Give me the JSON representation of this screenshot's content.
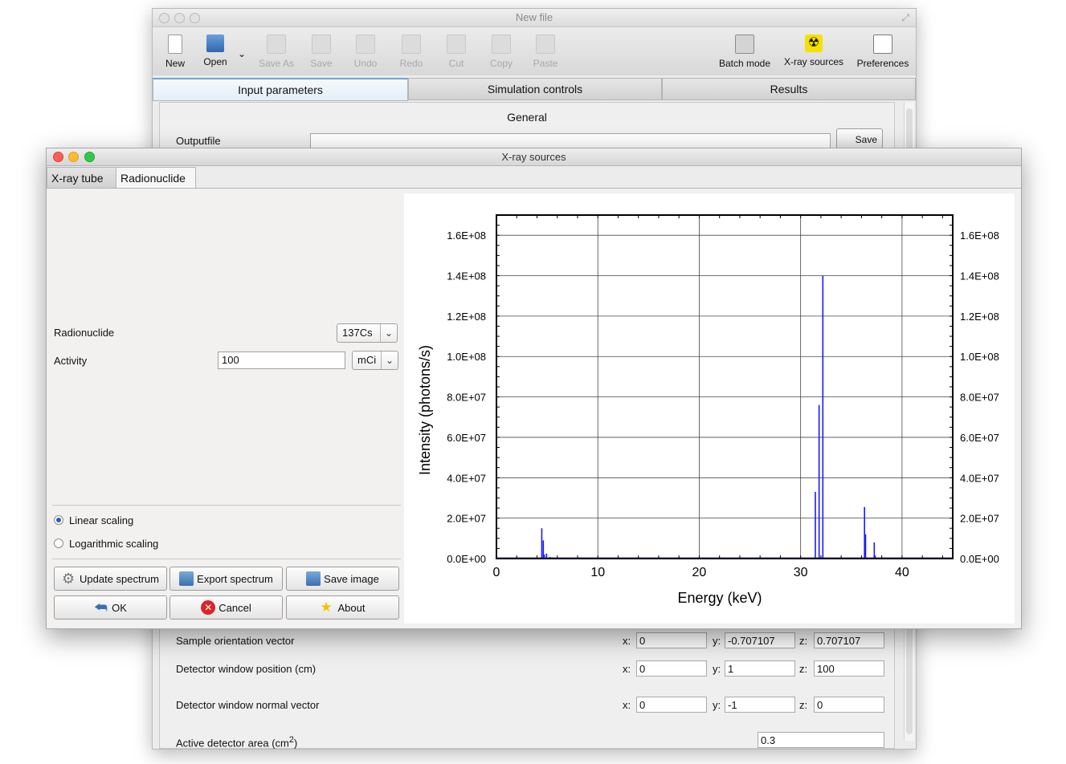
{
  "main_window": {
    "title": "New file",
    "toolbar": [
      {
        "label": "New",
        "icon": "new-file-icon",
        "enabled": true
      },
      {
        "label": "Open",
        "icon": "open-folder-icon",
        "enabled": true
      },
      {
        "label": "Save As",
        "icon": "save-as-icon",
        "enabled": false
      },
      {
        "label": "Save",
        "icon": "save-icon",
        "enabled": false
      },
      {
        "label": "Undo",
        "icon": "undo-icon",
        "enabled": false
      },
      {
        "label": "Redo",
        "icon": "redo-icon",
        "enabled": false
      },
      {
        "label": "Cut",
        "icon": "scissors-icon",
        "enabled": false
      },
      {
        "label": "Copy",
        "icon": "copy-icon",
        "enabled": false
      },
      {
        "label": "Paste",
        "icon": "paste-icon",
        "enabled": false
      }
    ],
    "toolbar_right": [
      {
        "label": "Batch mode",
        "icon": "batch-mode-icon"
      },
      {
        "label": "X-ray sources",
        "icon": "radiation-icon"
      },
      {
        "label": "Preferences",
        "icon": "preferences-icon"
      }
    ],
    "tabs": [
      "Input parameters",
      "Simulation controls",
      "Results"
    ],
    "active_tab": "Input parameters",
    "section_title": "General",
    "outputfile_label": "Outputfile",
    "save_button_label": "Save",
    "params": {
      "sample_orientation": {
        "label": "Sample orientation vector",
        "x": "0",
        "y": "-0.707107",
        "z": "0.707107"
      },
      "detector_window_position": {
        "label": "Detector window position (cm)",
        "x": "0",
        "y": "1",
        "z": "100"
      },
      "detector_window_normal": {
        "label": "Detector window normal vector",
        "x": "0",
        "y": "-1",
        "z": "0"
      },
      "active_detector_area": {
        "label": "Active detector area (cm",
        "sup": "2",
        "close": ")",
        "value": "0.3"
      }
    },
    "axis_letters": {
      "x": "x:",
      "y": "y:",
      "z": "z:"
    }
  },
  "dialog": {
    "title": "X-ray sources",
    "tabs": [
      "X-ray tube",
      "Radionuclide"
    ],
    "active_tab": "Radionuclide",
    "radionuclide_label": "Radionuclide",
    "radionuclide_value": "137Cs",
    "activity_label": "Activity",
    "activity_value": "100",
    "activity_unit": "mCi",
    "scaling_options": [
      {
        "label": "Linear scaling",
        "selected": true
      },
      {
        "label": "Logarithmic scaling",
        "selected": false
      }
    ],
    "buttons": {
      "update_spectrum": "Update spectrum",
      "export_spectrum": "Export spectrum",
      "save_image": "Save image",
      "ok": "OK",
      "cancel": "Cancel",
      "about": "About"
    }
  },
  "chart_data": {
    "type": "line",
    "xlabel": "Energy (keV)",
    "ylabel": "Intensity (photons/s)",
    "xlim": [
      0,
      45
    ],
    "ylim": [
      0,
      170000000.0
    ],
    "xticks": [
      0,
      10,
      20,
      30,
      40
    ],
    "yticks": [
      0,
      20000000.0,
      40000000.0,
      60000000.0,
      80000000.0,
      100000000.0,
      120000000.0,
      140000000.0,
      160000000.0
    ],
    "ytick_labels": [
      "0.0E+00",
      "2.0E+07",
      "4.0E+07",
      "6.0E+07",
      "8.0E+07",
      "1.0E+08",
      "1.2E+08",
      "1.4E+08",
      "1.6E+08"
    ],
    "grid": true,
    "series_color": "#1a1aff",
    "peaks": [
      {
        "x": 3.3,
        "y": 400000.0
      },
      {
        "x": 4.47,
        "y": 15000000.0
      },
      {
        "x": 4.62,
        "y": 9000000.0
      },
      {
        "x": 4.72,
        "y": 2000000.0
      },
      {
        "x": 4.94,
        "y": 2500000.0
      },
      {
        "x": 5.28,
        "y": 800000.0
      },
      {
        "x": 5.55,
        "y": 500000.0
      },
      {
        "x": 31.45,
        "y": 33000000.0
      },
      {
        "x": 31.82,
        "y": 76000000.0
      },
      {
        "x": 32.19,
        "y": 140000000.0
      },
      {
        "x": 36.3,
        "y": 25500000.0
      },
      {
        "x": 36.4,
        "y": 12000000.0
      },
      {
        "x": 37.26,
        "y": 8000000.0
      },
      {
        "x": 37.35,
        "y": 1500000.0
      }
    ]
  }
}
